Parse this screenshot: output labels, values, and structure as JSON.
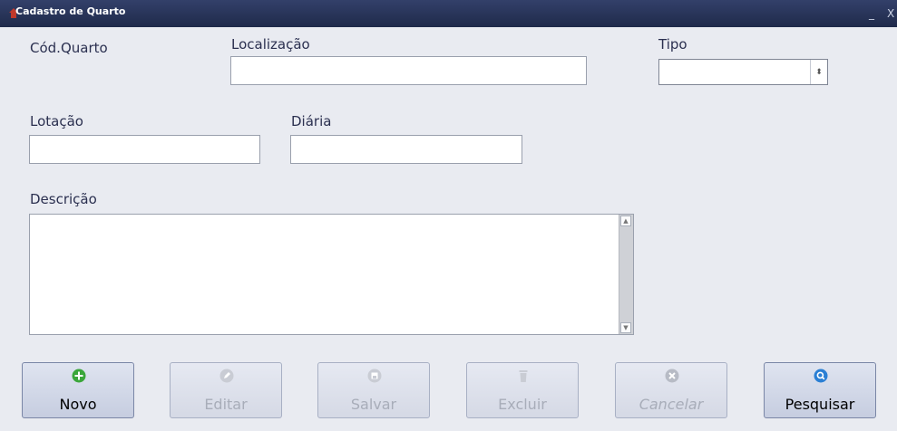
{
  "window": {
    "title": "Cadastro de Quarto",
    "minimize": "_",
    "close": "X"
  },
  "form": {
    "cod_label": "Cód.Quarto",
    "localizacao_label": "Localização",
    "tipo_label": "Tipo",
    "lotacao_label": "Lotação",
    "diaria_label": "Diária",
    "descricao_label": "Descrição",
    "localizacao_value": "",
    "tipo_value": "",
    "lotacao_value": "",
    "diaria_value": "",
    "descricao_value": ""
  },
  "buttons": {
    "novo": "Novo",
    "editar": "Editar",
    "salvar": "Salvar",
    "excluir": "Excluir",
    "cancelar": "Cancelar",
    "pesquisar": "Pesquisar"
  },
  "colors": {
    "titlebar": "#1f2a4a",
    "window_bg": "#e9ebf1",
    "novo_icon": "#3aa63a",
    "pesquisar_icon": "#2a7fd4"
  },
  "icons": [
    "app-icon",
    "plus-circle-icon",
    "pencil-icon",
    "floppy-disk-icon",
    "trash-icon",
    "x-circle-icon",
    "search-circle-icon"
  ]
}
